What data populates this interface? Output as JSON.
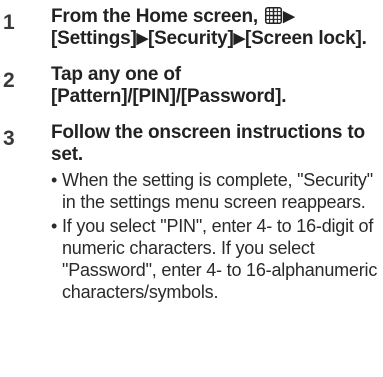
{
  "steps": [
    {
      "number": "1",
      "parts": {
        "prefix": "From the Home screen,",
        "arrow": "▶",
        "item1": "[Settings]",
        "item2": "[Security]",
        "item3": "[Screen lock]."
      }
    },
    {
      "number": "2",
      "text": "Tap any one of [Pattern]/[PIN]/[Password]."
    },
    {
      "number": "3",
      "text": "Follow the onscreen instructions to set.",
      "notes": [
        "When the setting is complete, \"Security\" in the settings menu screen reappears.",
        "If you select \"PIN\", enter 4- to 16-digit of numeric characters. If you select \"Password\", enter 4- to 16-alphanumeric characters/symbols."
      ]
    }
  ],
  "bullet": "•",
  "icons": {
    "home_menu": "apps-grid-icon"
  }
}
